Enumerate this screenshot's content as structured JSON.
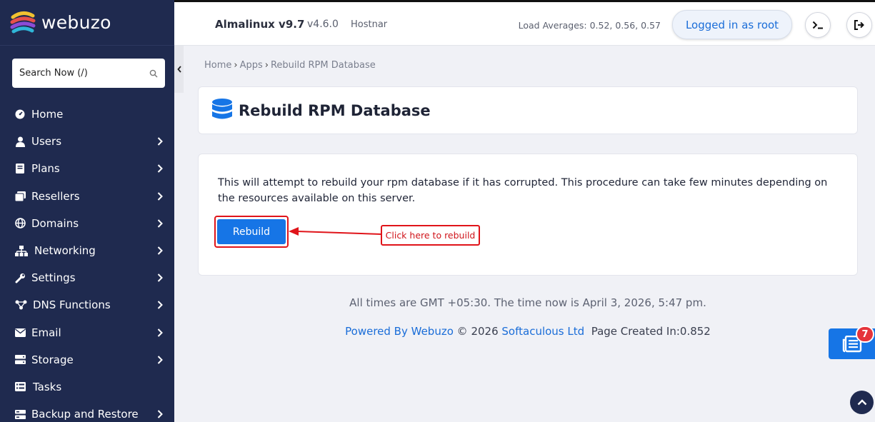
{
  "brand": {
    "name": "webuzo"
  },
  "search": {
    "placeholder": "Search Now (/)"
  },
  "sidebar": {
    "items": [
      {
        "label": "Home",
        "icon": "dashboard-icon",
        "expandable": false
      },
      {
        "label": "Users",
        "icon": "user-icon",
        "expandable": true
      },
      {
        "label": "Plans",
        "icon": "book-icon",
        "expandable": true
      },
      {
        "label": "Resellers",
        "icon": "resellers-icon",
        "expandable": true
      },
      {
        "label": "Domains",
        "icon": "globe-icon",
        "expandable": true
      },
      {
        "label": "Networking",
        "icon": "network-icon",
        "expandable": true
      },
      {
        "label": "Settings",
        "icon": "wrench-icon",
        "expandable": true
      },
      {
        "label": "DNS Functions",
        "icon": "dns-icon",
        "expandable": true
      },
      {
        "label": "Email",
        "icon": "envelope-icon",
        "expandable": true
      },
      {
        "label": "Storage",
        "icon": "storage-icon",
        "expandable": true
      },
      {
        "label": "Tasks",
        "icon": "tasks-icon",
        "expandable": false
      },
      {
        "label": "Backup and Restore",
        "icon": "backup-icon",
        "expandable": true
      }
    ]
  },
  "topbar": {
    "os_name": "Almalinux v9.7",
    "version": "v4.6.0",
    "hostname": "Hostnar",
    "load_averages": "Load Averages: 0.52, 0.56, 0.57",
    "login_label": "Logged in as root"
  },
  "breadcrumb": {
    "home": "Home",
    "apps": "Apps",
    "current": "Rebuild RPM Database"
  },
  "page": {
    "title": "Rebuild RPM Database",
    "description": "This will attempt to rebuild your rpm database if it has corrupted. This procedure can take few minutes depending on the resources available on this server.",
    "rebuild_label": "Rebuild",
    "callout": "Click here to rebuild"
  },
  "footer": {
    "time_text": "All times are GMT +05:30. The time now is April 3, 2026, 5:47 pm.",
    "powered_by": "Powered By Webuzo",
    "copyright": "© 2026",
    "company": "Softaculous Ltd",
    "page_created": "Page Created In:0.852"
  },
  "news": {
    "count": "7"
  },
  "colors": {
    "sidebar_bg": "#1f2a4f",
    "primary": "#1675e6",
    "highlight": "#e0141a"
  }
}
